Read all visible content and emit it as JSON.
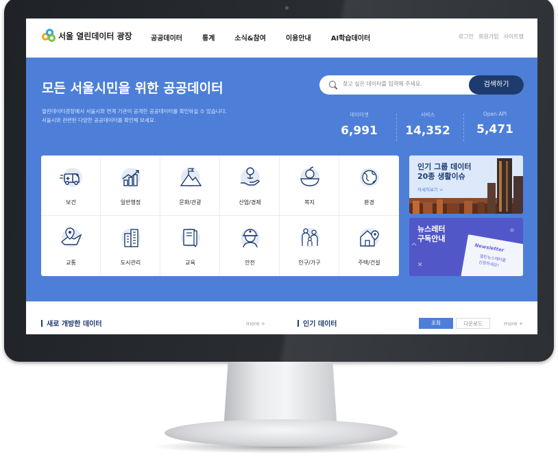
{
  "brand": {
    "name": "서울 열린데이터 광장"
  },
  "nav": {
    "menu": [
      "공공데이터",
      "통계",
      "소식&참여",
      "이용안내",
      "AI학습데이터"
    ],
    "util": [
      "로그인",
      "회원가입",
      "사이트맵"
    ]
  },
  "hero": {
    "title": "모든 서울시민을 위한 공공데이터",
    "desc1": "열린데이터광장에서 서울시와 연계 기관이 공개한 공공데이터를 확인하실 수 있습니다.",
    "desc2": "서울시와 관련된 다양한 공공데이터를 확인해 보세요.",
    "search_placeholder": "찾고 싶은 데이터를 입력해 주세요.",
    "search_button": "검색하기",
    "stats": [
      {
        "label": "데이터셋",
        "value": "6,991"
      },
      {
        "label": "서비스",
        "value": "14,352"
      },
      {
        "label": "Open API",
        "value": "5,471"
      }
    ]
  },
  "categories": [
    {
      "label": "보건",
      "icon": "ambulance-icon"
    },
    {
      "label": "일반행정",
      "icon": "growth-chart-icon"
    },
    {
      "label": "문화/관광",
      "icon": "mountain-flag-icon"
    },
    {
      "label": "산업/경제",
      "icon": "coin-hand-icon"
    },
    {
      "label": "복지",
      "icon": "apple-bowl-icon"
    },
    {
      "label": "환경",
      "icon": "earth-icon"
    },
    {
      "label": "교통",
      "icon": "map-pin-icon"
    },
    {
      "label": "도시관리",
      "icon": "buildings-icon"
    },
    {
      "label": "교육",
      "icon": "book-pencil-icon"
    },
    {
      "label": "안전",
      "icon": "helmet-worker-icon"
    },
    {
      "label": "인구/가구",
      "icon": "family-icon"
    },
    {
      "label": "주택/건설",
      "icon": "house-location-icon"
    }
  ],
  "banners": {
    "popular": {
      "line1": "인기 그룹 데이터",
      "line2": "20종 생활이슈",
      "link": "자세히보기 >"
    },
    "newsletter": {
      "line1": "뉴스레터",
      "line2": "구독안내",
      "card_title": "Newsletter",
      "card_sub1": "열린뉴스레터를",
      "card_sub2": "신청하세요!",
      "close": "✕"
    }
  },
  "bottom": {
    "new_title": "새로 개방한 데이터",
    "more": "more +",
    "popular_title": "인기 데이터",
    "tab_views": "조회",
    "tab_downloads": "다운로드",
    "more2": "more +"
  },
  "colors": {
    "hero": "#4d7fd8",
    "navy": "#1d3b6e",
    "accent_purple": "#5257c8"
  }
}
